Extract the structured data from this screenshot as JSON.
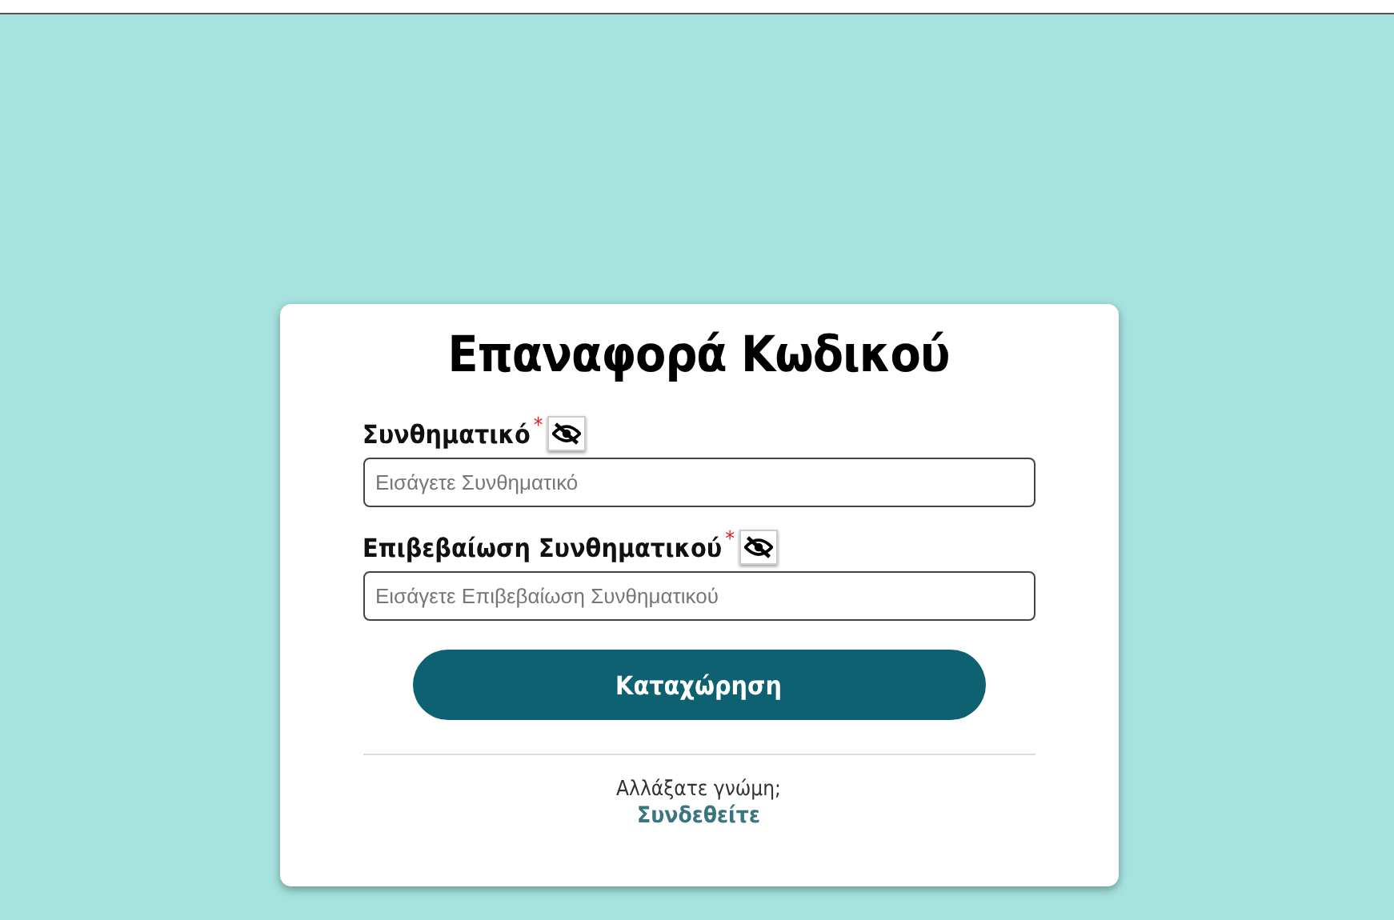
{
  "form": {
    "title": "Επαναφορά Κωδικού",
    "fields": [
      {
        "label": "Συνθηματικό",
        "required": true,
        "placeholder": "Εισάγετε Συνθηματικό",
        "visible": false
      },
      {
        "label": "Επιβεβαίωση Συνθηματικού",
        "required": true,
        "placeholder": "Εισάγετε Επιβεβαίωση Συνθηματικού",
        "visible": false
      }
    ],
    "required_mark": "*",
    "submit": "Καταχώρηση",
    "footer_text": "Αλλάξατε γνώμη;",
    "footer_link": "Συνδεθείτε"
  }
}
